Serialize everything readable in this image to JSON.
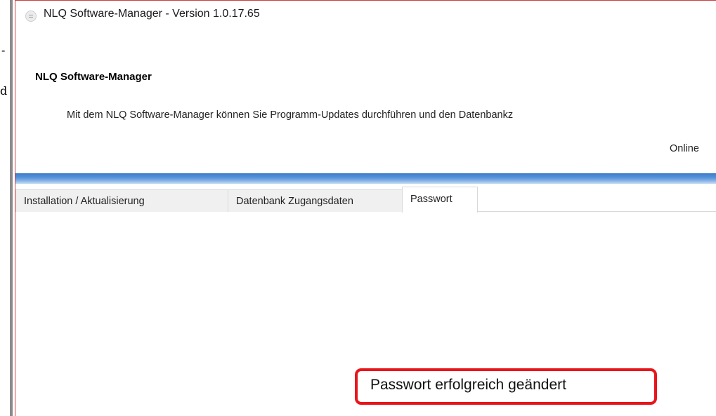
{
  "left_fragment": {
    "line_1": "-",
    "line_2": "d"
  },
  "window": {
    "title": "NLQ Software-Manager - Version 1.0.17.65"
  },
  "header": {
    "title": "NLQ Software-Manager",
    "description": "Mit dem NLQ Software-Manager können Sie Programm-Updates durchführen und den Datenbankz",
    "status": "Online"
  },
  "tabs": [
    {
      "label": "Installation / Aktualisierung",
      "active": false
    },
    {
      "label": "Datenbank Zugangsdaten",
      "active": false
    },
    {
      "label": "Passwort",
      "active": true
    }
  ],
  "message": {
    "text": "Passwort erfolgreich geändert",
    "border_color": "#e8151b"
  },
  "colors": {
    "progress_blue": "#3b79c8"
  },
  "icons": {
    "app": "app-icon"
  }
}
